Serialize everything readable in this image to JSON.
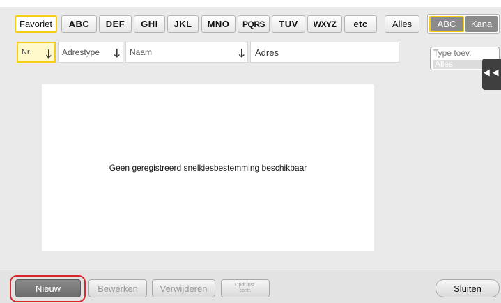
{
  "tabs": {
    "favoriet": "Favoriet",
    "abc": "ABC",
    "def": "DEF",
    "ghi": "GHI",
    "jkl": "JKL",
    "mno": "MNO",
    "pqrs": "PQRS",
    "tuv": "TUV",
    "wxyz": "WXYZ",
    "etc": "etc",
    "alles": "Alles"
  },
  "char_mode": {
    "abc": "ABC",
    "kana": "Kana",
    "selected": "ABC"
  },
  "columns": {
    "nr": "Nr.",
    "adrestype": "Adrestype",
    "naam": "Naam",
    "adres": "Adres"
  },
  "type_filter": {
    "label": "Type toev.",
    "value": "Alles"
  },
  "list": {
    "empty_message": "Geen geregistreerd snelkiesbestemming beschikbaar"
  },
  "buttons": {
    "nieuw": "Nieuw",
    "bewerken": "Bewerken",
    "verwijderen": "Verwijderen",
    "opdr_line1": "Opdr.inst.",
    "opdr_line2": "contr.",
    "sluiten": "Sluiten"
  },
  "icons": {
    "sort": "arrow-down-icon",
    "side_panel": "double-chevron-left-icon"
  },
  "colors": {
    "highlight": "#f5cd16",
    "alert_ring": "#d9262f",
    "selected_button": "#7a7a7a"
  }
}
